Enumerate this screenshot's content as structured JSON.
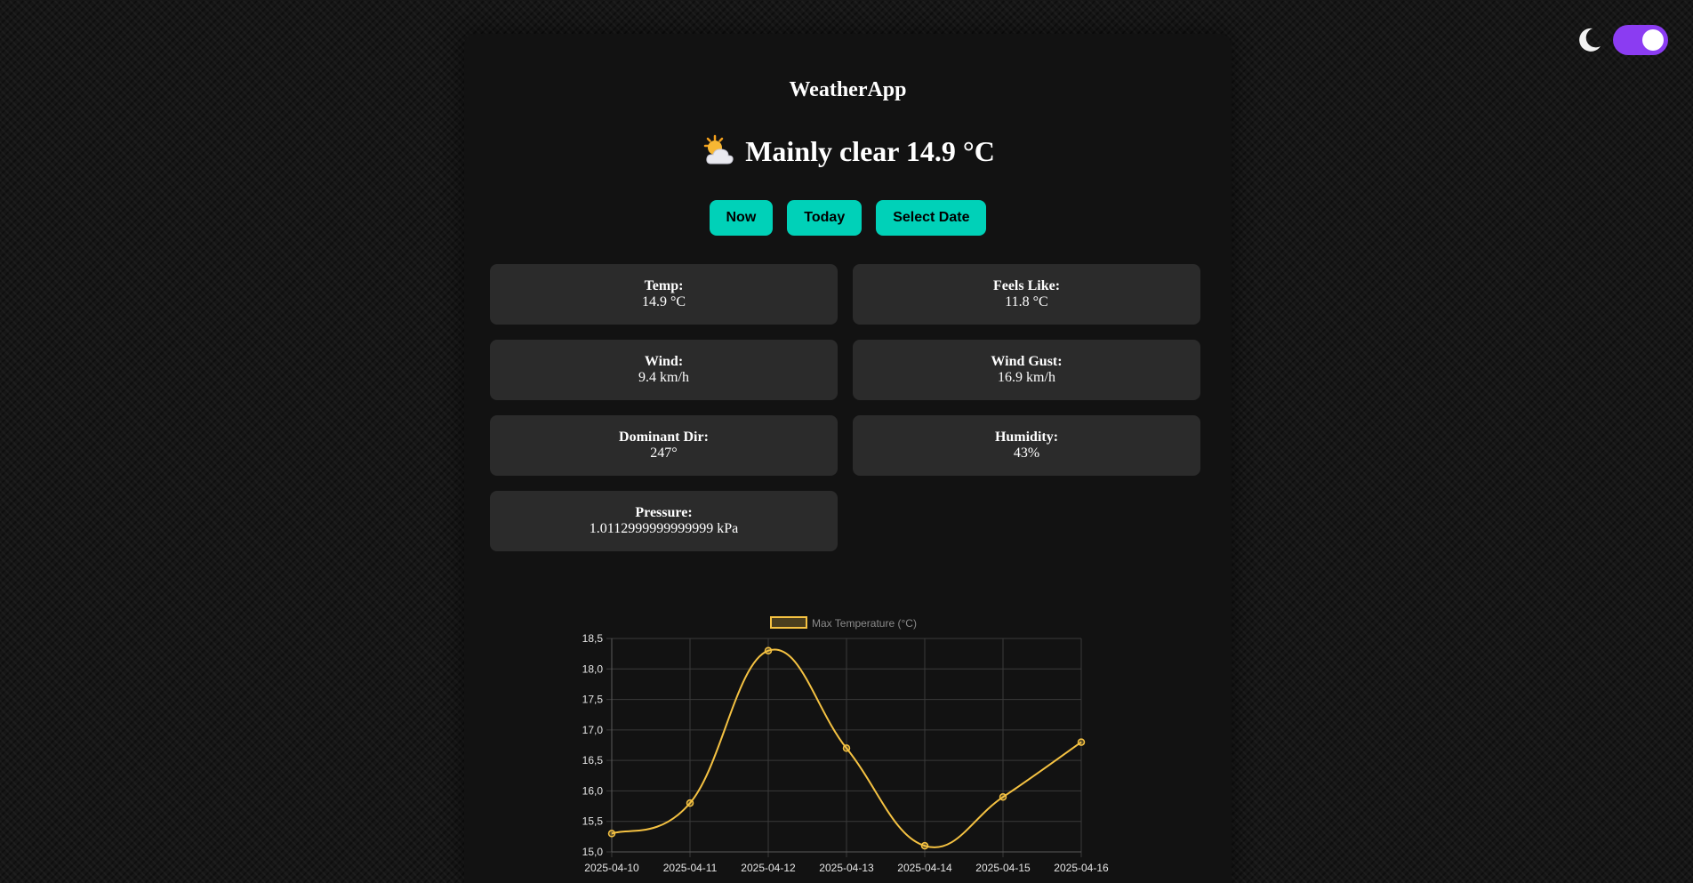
{
  "theme_toggle": {
    "moon_icon": "moon-icon",
    "enabled": true,
    "color": "#8b3cf2"
  },
  "app": {
    "title": "WeatherApp",
    "condition_icon": "sun-behind-cloud-icon",
    "condition": "Mainly clear 14.9 °C"
  },
  "buttons": {
    "now": "Now",
    "today": "Today",
    "select_date": "Select Date",
    "color": "#00d1b8"
  },
  "metrics": [
    {
      "label": "Temp:",
      "value": "14.9 °C"
    },
    {
      "label": "Feels Like:",
      "value": "11.8 °C"
    },
    {
      "label": "Wind:",
      "value": "9.4 km/h"
    },
    {
      "label": "Wind Gust:",
      "value": "16.9 km/h"
    },
    {
      "label": "Dominant Dir:",
      "value": "247°"
    },
    {
      "label": "Humidity:",
      "value": "43%"
    },
    {
      "label": "Pressure:",
      "value": "1.0112999999999999 kPa"
    }
  ],
  "chart_data": {
    "type": "line",
    "x": [
      "2025-04-10",
      "2025-04-11",
      "2025-04-12",
      "2025-04-13",
      "2025-04-14",
      "2025-04-15",
      "2025-04-16"
    ],
    "series": [
      {
        "name": "Max Temperature (°C)",
        "values": [
          15.3,
          15.8,
          18.3,
          16.7,
          15.1,
          15.9,
          16.8
        ],
        "color": "#f5c242"
      }
    ],
    "ylim": [
      15.0,
      18.5
    ],
    "yticks": [
      "15,0",
      "15,5",
      "16,0",
      "16,5",
      "17,0",
      "17,5",
      "18,0",
      "18,5"
    ],
    "grid": true,
    "legend": "top-center",
    "smooth": true
  }
}
